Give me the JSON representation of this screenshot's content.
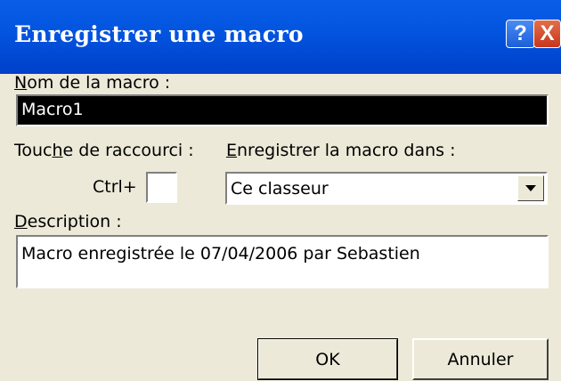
{
  "window": {
    "title": "Enregistrer une macro",
    "help_glyph": "?",
    "close_glyph": "X"
  },
  "macro_name": {
    "label_first": "N",
    "label_rest": "om de la macro :",
    "value": "Macro1"
  },
  "shortcut": {
    "label_pre": "Touc",
    "label_accel": "h",
    "label_post": "e de raccourci :",
    "prefix": "Ctrl+",
    "value": ""
  },
  "store_in": {
    "label_first": "E",
    "label_rest": "nregistrer la macro dans :",
    "selected": "Ce classeur"
  },
  "description": {
    "label_first": "D",
    "label_rest": "escription :",
    "value": "Macro enregistrée le 07/04/2006 par Sebastien"
  },
  "buttons": {
    "ok": "OK",
    "cancel": "Annuler"
  },
  "colors": {
    "titlebar": "#0254df",
    "dialog_bg": "#ece9d8",
    "close_button": "#c6371d"
  }
}
